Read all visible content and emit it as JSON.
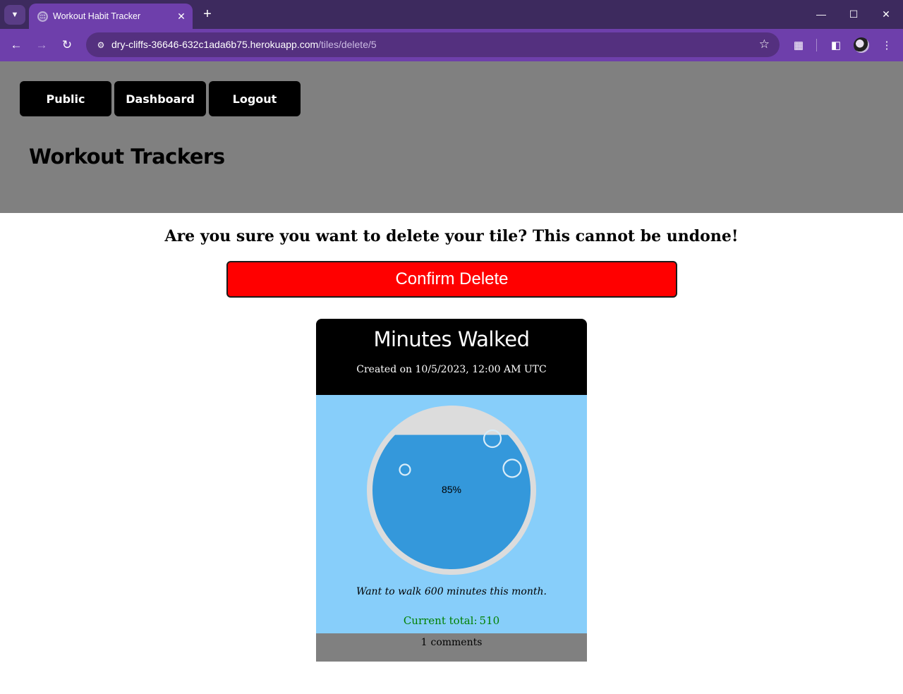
{
  "browser": {
    "tab_title": "Workout Habit Tracker",
    "url_host": "dry-cliffs-36646-632c1ada6b75.herokuapp.com",
    "url_path": "/tiles/delete/5"
  },
  "nav": {
    "public_label": "Public",
    "dashboard_label": "Dashboard",
    "logout_label": "Logout"
  },
  "site_title": "Workout Trackers",
  "confirm": {
    "message": "Are you sure you want to delete your tile? This cannot be undone!",
    "button_label": "Confirm Delete",
    "button_color": "#ff0000"
  },
  "tile": {
    "title": "Minutes Walked",
    "created": "Created on 10/5/2023, 12:00 AM UTC",
    "progress_fraction": 0.85,
    "progress_label": "85%",
    "goal_text": "Want to walk 600 minutes this month.",
    "total_label": "Current total:",
    "total_value": "510",
    "comment_count": "1",
    "comment_label": "comments",
    "water_color": "#3498db",
    "body_color": "#87cefa",
    "total_color": "#008000"
  }
}
